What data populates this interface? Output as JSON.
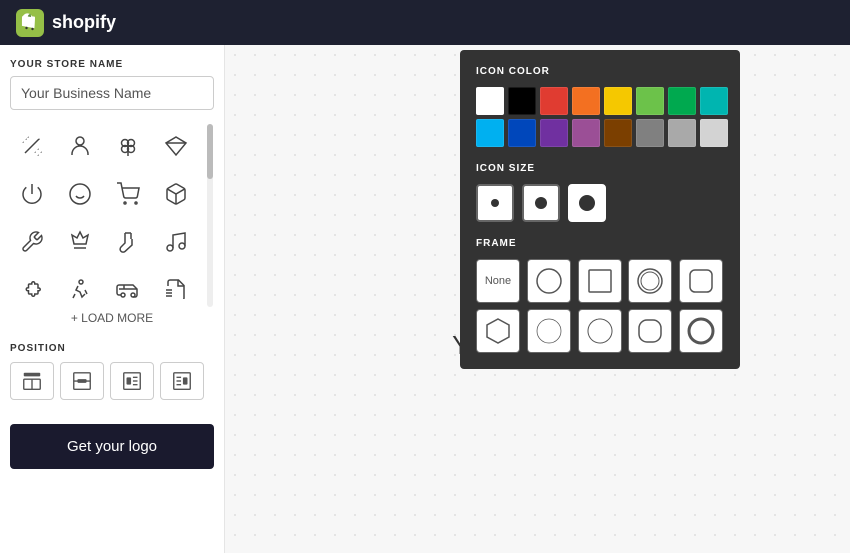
{
  "header": {
    "brand": "shopify",
    "logo_alt": "Shopify"
  },
  "left_panel": {
    "store_name_label": "YOUR STORE NAME",
    "store_name_placeholder": "Your Business Name",
    "store_name_value": "Your Business Name",
    "load_more_label": "+ LOAD MORE",
    "position_label": "POSITION",
    "get_logo_label": "Get your logo",
    "icons": [
      "magic-wand",
      "person",
      "clover",
      "diamond",
      "power",
      "smiley",
      "cart",
      "box",
      "tool",
      "crown",
      "sock",
      "music",
      "puzzle",
      "runner",
      "car",
      "newspaper"
    ]
  },
  "popup": {
    "icon_color_label": "ICON COLOR",
    "icon_size_label": "ICON SIZE",
    "frame_label": "FRAME",
    "colors": [
      "#ffffff",
      "#000000",
      "#e03c31",
      "#f37021",
      "#f5c800",
      "#6cc24a",
      "#00a94f",
      "#00b5b0",
      "#00b0f0",
      "#0047bb",
      "#7030a0",
      "#9b4f96",
      "#7b3f00",
      "#808080",
      "#a9a9a9",
      "#d3d3d3"
    ],
    "sizes": [
      "small",
      "medium",
      "large"
    ],
    "active_size": "large",
    "frames": [
      "none",
      "circle",
      "square",
      "circle-outline",
      "rounded-square",
      "hexagon",
      "thin-circle",
      "light-circle",
      "rounded-rect",
      "circle-thick"
    ]
  },
  "preview": {
    "business_name": "Your Business Name"
  }
}
